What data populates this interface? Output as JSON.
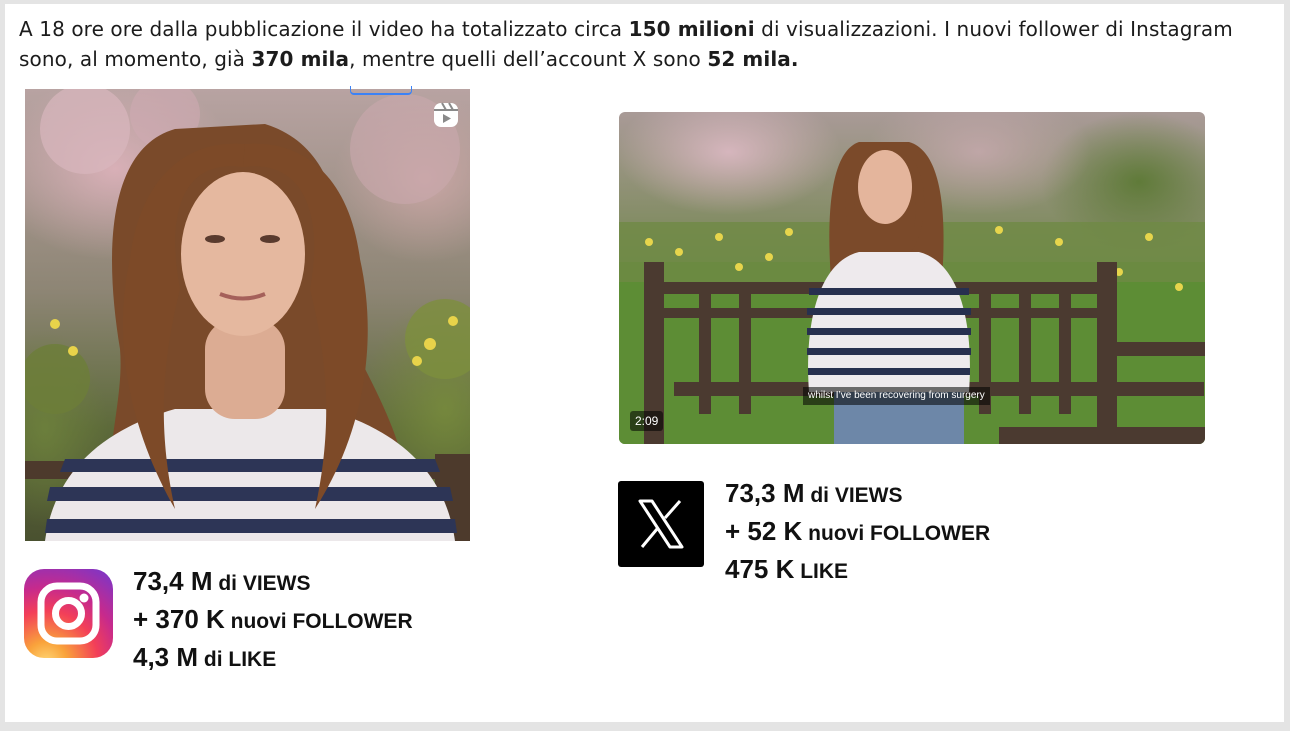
{
  "intro": {
    "t1": "A 18 ore ore dalla pubblicazione il video ha totalizzato circa ",
    "b1": "150 milioni",
    "t2": " di visualizzazioni. I nuovi follower di Instagram sono, al momento, già ",
    "b2": "370 mila",
    "t3": ", mentre quelli dell’account X sono ",
    "b3": "52 mila."
  },
  "instagram": {
    "icon": "instagram-logo-icon",
    "reel_icon": "reels-icon",
    "stats": [
      {
        "value": "73,4 M",
        "label": " di VIEWS"
      },
      {
        "value": "+ 370 K",
        "label": " nuovi FOLLOWER"
      },
      {
        "value": "4,3 M",
        "label": " di LIKE"
      }
    ]
  },
  "x": {
    "icon": "x-logo-icon",
    "duration": "2:09",
    "subtitle": "whilst I’ve been recovering from surgery",
    "stats": [
      {
        "value": "73,3 M",
        "label": " di VIEWS"
      },
      {
        "value": "+ 52 K",
        "label": " nuovi FOLLOWER"
      },
      {
        "value": "475 K",
        "label": " LIKE"
      }
    ]
  }
}
